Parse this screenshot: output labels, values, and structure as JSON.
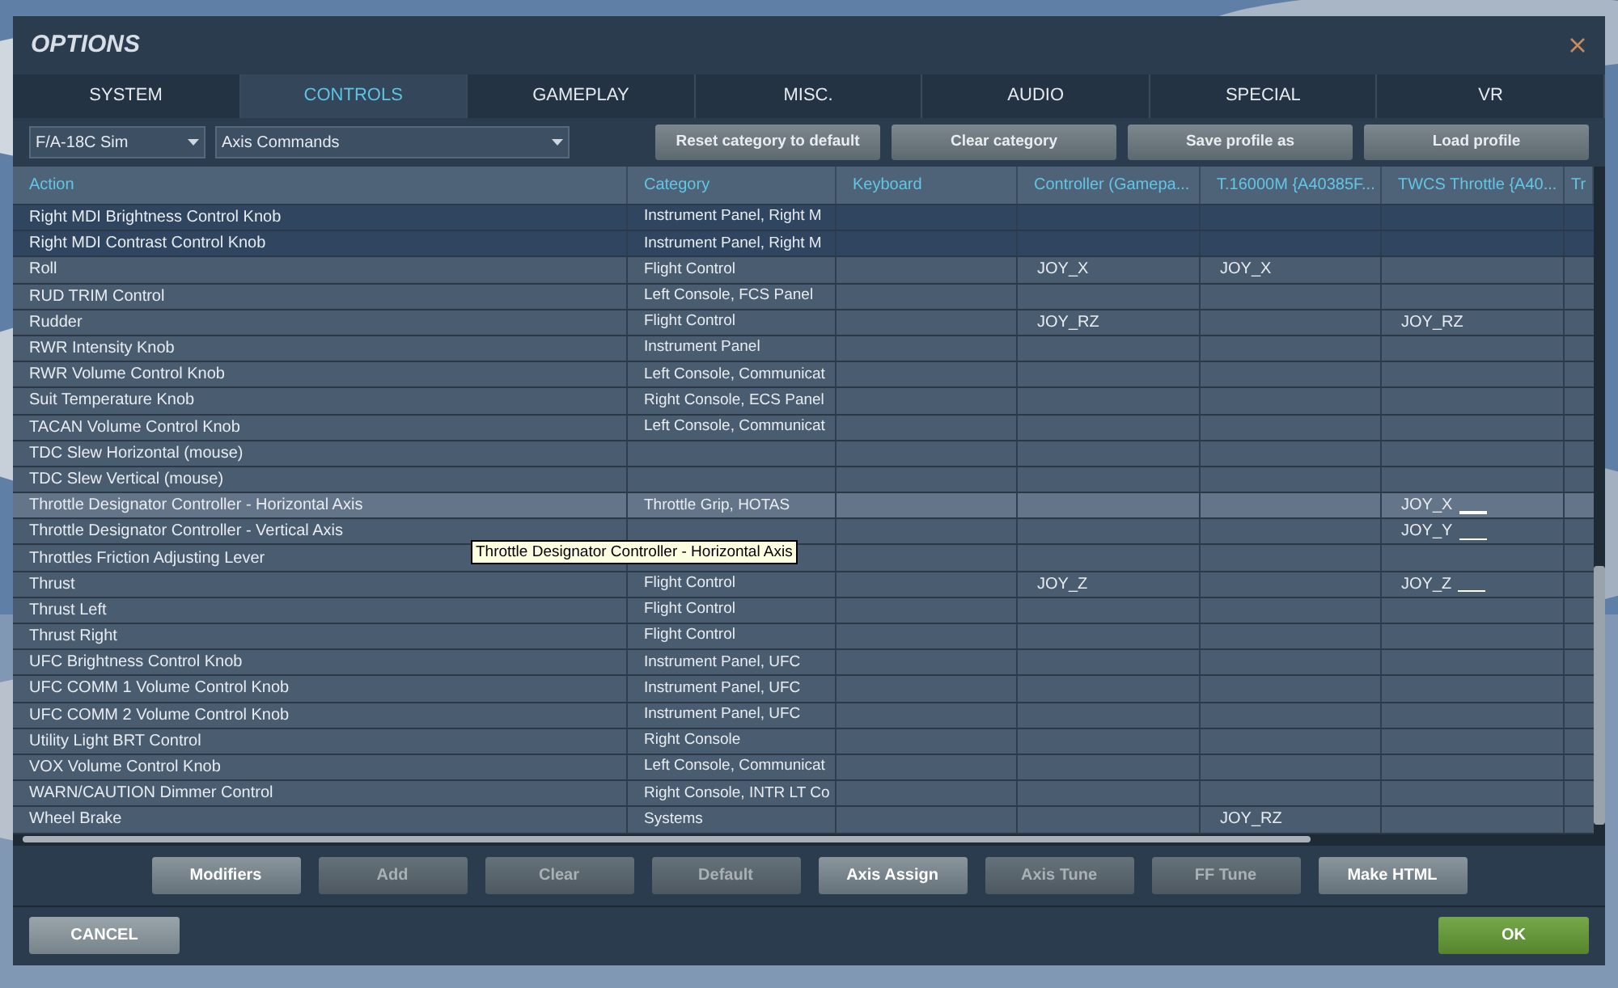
{
  "window": {
    "title": "OPTIONS"
  },
  "tabs": [
    {
      "label": "SYSTEM",
      "selected": false
    },
    {
      "label": "CONTROLS",
      "selected": true
    },
    {
      "label": "GAMEPLAY",
      "selected": false
    },
    {
      "label": "MISC.",
      "selected": false
    },
    {
      "label": "AUDIO",
      "selected": false
    },
    {
      "label": "SPECIAL",
      "selected": false
    },
    {
      "label": "VR",
      "selected": false
    }
  ],
  "dropdowns": [
    {
      "value": "F/A-18C Sim"
    },
    {
      "value": "Axis Commands"
    }
  ],
  "toolbar_buttons": [
    "Reset category to default",
    "Clear category",
    "Save profile as",
    "Load profile"
  ],
  "table": {
    "columns": [
      "Action",
      "Category",
      "Keyboard",
      "Controller (Gamepa...",
      "T.16000M {A40385F...",
      "TWCS Throttle {A40...",
      "Tr"
    ],
    "rows": [
      {
        "cells": [
          "Right MDI Brightness Control Knob",
          "Instrument Panel, Right M",
          "",
          "",
          "",
          ""
        ],
        "selected": false,
        "marked": false
      },
      {
        "cells": [
          "Right MDI Contrast Control Knob",
          "Instrument Panel, Right M",
          "",
          "",
          "",
          ""
        ],
        "selected": false,
        "marked": false
      },
      {
        "cells": [
          "Roll",
          "Flight Control",
          "",
          "JOY_X",
          "JOY_X",
          ""
        ],
        "selected": false,
        "marked": false
      },
      {
        "cells": [
          "RUD TRIM Control",
          "Left Console, FCS Panel",
          "",
          "",
          "",
          ""
        ],
        "selected": false,
        "marked": false
      },
      {
        "cells": [
          "Rudder",
          "Flight Control",
          "",
          "JOY_RZ",
          "",
          "JOY_RZ"
        ],
        "selected": false,
        "marked": false
      },
      {
        "cells": [
          "RWR Intensity Knob",
          "Instrument Panel",
          "",
          "",
          "",
          ""
        ],
        "selected": false,
        "marked": false
      },
      {
        "cells": [
          "RWR Volume Control Knob",
          "Left Console, Communicat",
          "",
          "",
          "",
          ""
        ],
        "selected": false,
        "marked": false
      },
      {
        "cells": [
          "Suit Temperature Knob",
          "Right Console, ECS Panel",
          "",
          "",
          "",
          ""
        ],
        "selected": false,
        "marked": false
      },
      {
        "cells": [
          "TACAN Volume Control Knob",
          "Left Console, Communicat",
          "",
          "",
          "",
          ""
        ],
        "selected": false,
        "marked": false
      },
      {
        "cells": [
          "TDC Slew Horizontal (mouse)",
          "",
          "",
          "",
          "",
          ""
        ],
        "selected": false,
        "marked": false
      },
      {
        "cells": [
          "TDC Slew Vertical (mouse)",
          "",
          "",
          "",
          "",
          ""
        ],
        "selected": false,
        "marked": false
      },
      {
        "cells": [
          "Throttle Designator Controller - Horizontal Axis",
          "Throttle Grip, HOTAS",
          "",
          "",
          "",
          "JOY_X"
        ],
        "selected": true,
        "marked": true
      },
      {
        "cells": [
          "Throttle Designator Controller - Vertical Axis",
          "",
          "",
          "",
          "",
          "JOY_Y"
        ],
        "selected": false,
        "marked": true
      },
      {
        "cells": [
          "Throttles Friction Adjusting Lever",
          "",
          "",
          "",
          "",
          ""
        ],
        "selected": false,
        "marked": false
      },
      {
        "cells": [
          "Thrust",
          "Flight Control",
          "",
          "JOY_Z",
          "",
          "JOY_Z"
        ],
        "selected": false,
        "marked": true
      },
      {
        "cells": [
          "Thrust Left",
          "Flight Control",
          "",
          "",
          "",
          ""
        ],
        "selected": false,
        "marked": false
      },
      {
        "cells": [
          "Thrust Right",
          "Flight Control",
          "",
          "",
          "",
          ""
        ],
        "selected": false,
        "marked": false
      },
      {
        "cells": [
          "UFC Brightness Control Knob",
          "Instrument Panel, UFC",
          "",
          "",
          "",
          ""
        ],
        "selected": false,
        "marked": false
      },
      {
        "cells": [
          "UFC COMM 1 Volume Control Knob",
          "Instrument Panel, UFC",
          "",
          "",
          "",
          ""
        ],
        "selected": false,
        "marked": false
      },
      {
        "cells": [
          "UFC COMM 2 Volume Control Knob",
          "Instrument Panel, UFC",
          "",
          "",
          "",
          ""
        ],
        "selected": false,
        "marked": false
      },
      {
        "cells": [
          "Utility Light BRT Control",
          "Right Console",
          "",
          "",
          "",
          ""
        ],
        "selected": false,
        "marked": false
      },
      {
        "cells": [
          "VOX Volume Control Knob",
          "Left Console, Communicat",
          "",
          "",
          "",
          ""
        ],
        "selected": false,
        "marked": false
      },
      {
        "cells": [
          "WARN/CAUTION Dimmer Control",
          "Right Console, INTR LT Co",
          "",
          "",
          "",
          ""
        ],
        "selected": false,
        "marked": false
      },
      {
        "cells": [
          "Wheel Brake",
          "Systems",
          "",
          "",
          "JOY_RZ",
          ""
        ],
        "selected": false,
        "marked": false
      }
    ]
  },
  "tooltip": "Throttle Designator Controller - Horizontal Axis",
  "action_buttons": [
    {
      "label": "Modifiers",
      "disabled": false
    },
    {
      "label": "Add",
      "disabled": true
    },
    {
      "label": "Clear",
      "disabled": true
    },
    {
      "label": "Default",
      "disabled": true
    },
    {
      "label": "Axis Assign",
      "disabled": false
    },
    {
      "label": "Axis Tune",
      "disabled": true
    },
    {
      "label": "FF Tune",
      "disabled": true
    },
    {
      "label": "Make HTML",
      "disabled": false
    }
  ],
  "footer": {
    "cancel": "CANCEL",
    "ok": "OK"
  }
}
